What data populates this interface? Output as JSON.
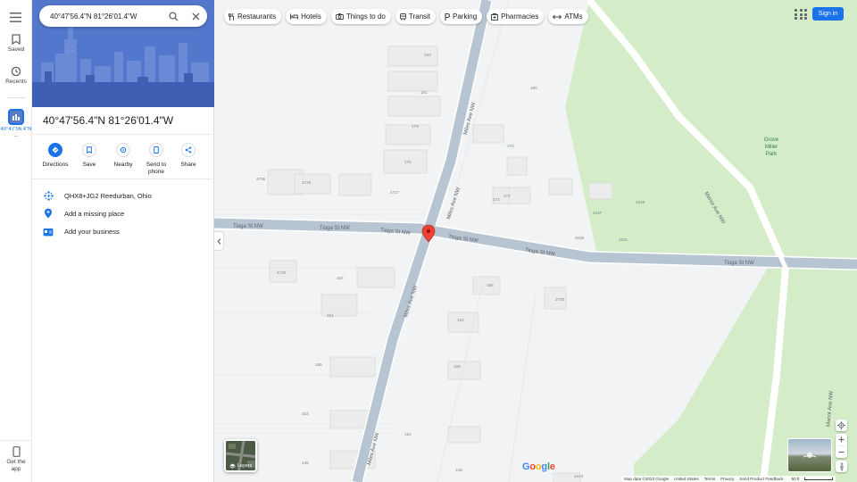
{
  "search": {
    "value": "40°47'56.4\"N 81°26'01.4\"W"
  },
  "rail": {
    "saved": "Saved",
    "recents": "Recents",
    "recent_place": "40°47'56.4\"N ...",
    "get_app": "Get the app"
  },
  "place": {
    "title": "40°47'56.4\"N 81°26'01.4\"W",
    "plus_code": "QHX8+JG2 Reedurban, Ohio",
    "add_missing_place": "Add a missing place",
    "add_business": "Add your business"
  },
  "actions": {
    "directions": "Directions",
    "save": "Save",
    "nearby": "Nearby",
    "send_to_phone": "Send to phone",
    "share": "Share"
  },
  "chips": [
    {
      "label": "Restaurants",
      "icon": "fork-knife-icon"
    },
    {
      "label": "Hotels",
      "icon": "bed-icon"
    },
    {
      "label": "Things to do",
      "icon": "camera-icon"
    },
    {
      "label": "Transit",
      "icon": "train-icon"
    },
    {
      "label": "Parking",
      "icon": "parking-icon"
    },
    {
      "label": "Pharmacies",
      "icon": "pharmacy-icon"
    },
    {
      "label": "ATMs",
      "icon": "atm-icon"
    }
  ],
  "header": {
    "sign_in": "Sign in"
  },
  "map": {
    "streets": {
      "tioga_1": "Tioga St NW",
      "tioga_2": "Tioga St NW",
      "tioga_3": "Tioga St NW",
      "tioga_4": "Tioga St NW",
      "tioga_5": "Tioga St NW",
      "tioga_6": "Tioga St NW",
      "miles_1": "Miles Ave NW",
      "miles_2": "Miles Ave NW",
      "miles_3": "Miles Ave NW",
      "miles_4": "Miles Ave NW",
      "manor_1": "Manor Ave NW",
      "manor_2": "Manor Ave NW"
    },
    "park": "Grove Miller Park",
    "house_numbers": [
      "183",
      "181",
      "179",
      "175",
      "180",
      "176",
      "4735",
      "4725",
      "4717",
      "172",
      "174",
      "4637",
      "4629",
      "4639",
      "4631",
      "4730",
      "167",
      "166",
      "2700",
      "161",
      "162",
      "159",
      "158",
      "153",
      "152",
      "149",
      "148",
      "4643"
    ],
    "layers_label": "Layers",
    "colors": {
      "park": "#d4edc8",
      "road": "#b7c4d2",
      "water": "#aadaff",
      "pin": "#ea4335"
    }
  },
  "footer": {
    "map_data": "Map data ©2023 Google",
    "country": "United States",
    "terms": "Terms",
    "privacy": "Privacy",
    "feedback": "Send Product Feedback",
    "scale": "50 ft"
  },
  "logo": "Google",
  "colors": {
    "accent": "#1a73e8"
  }
}
